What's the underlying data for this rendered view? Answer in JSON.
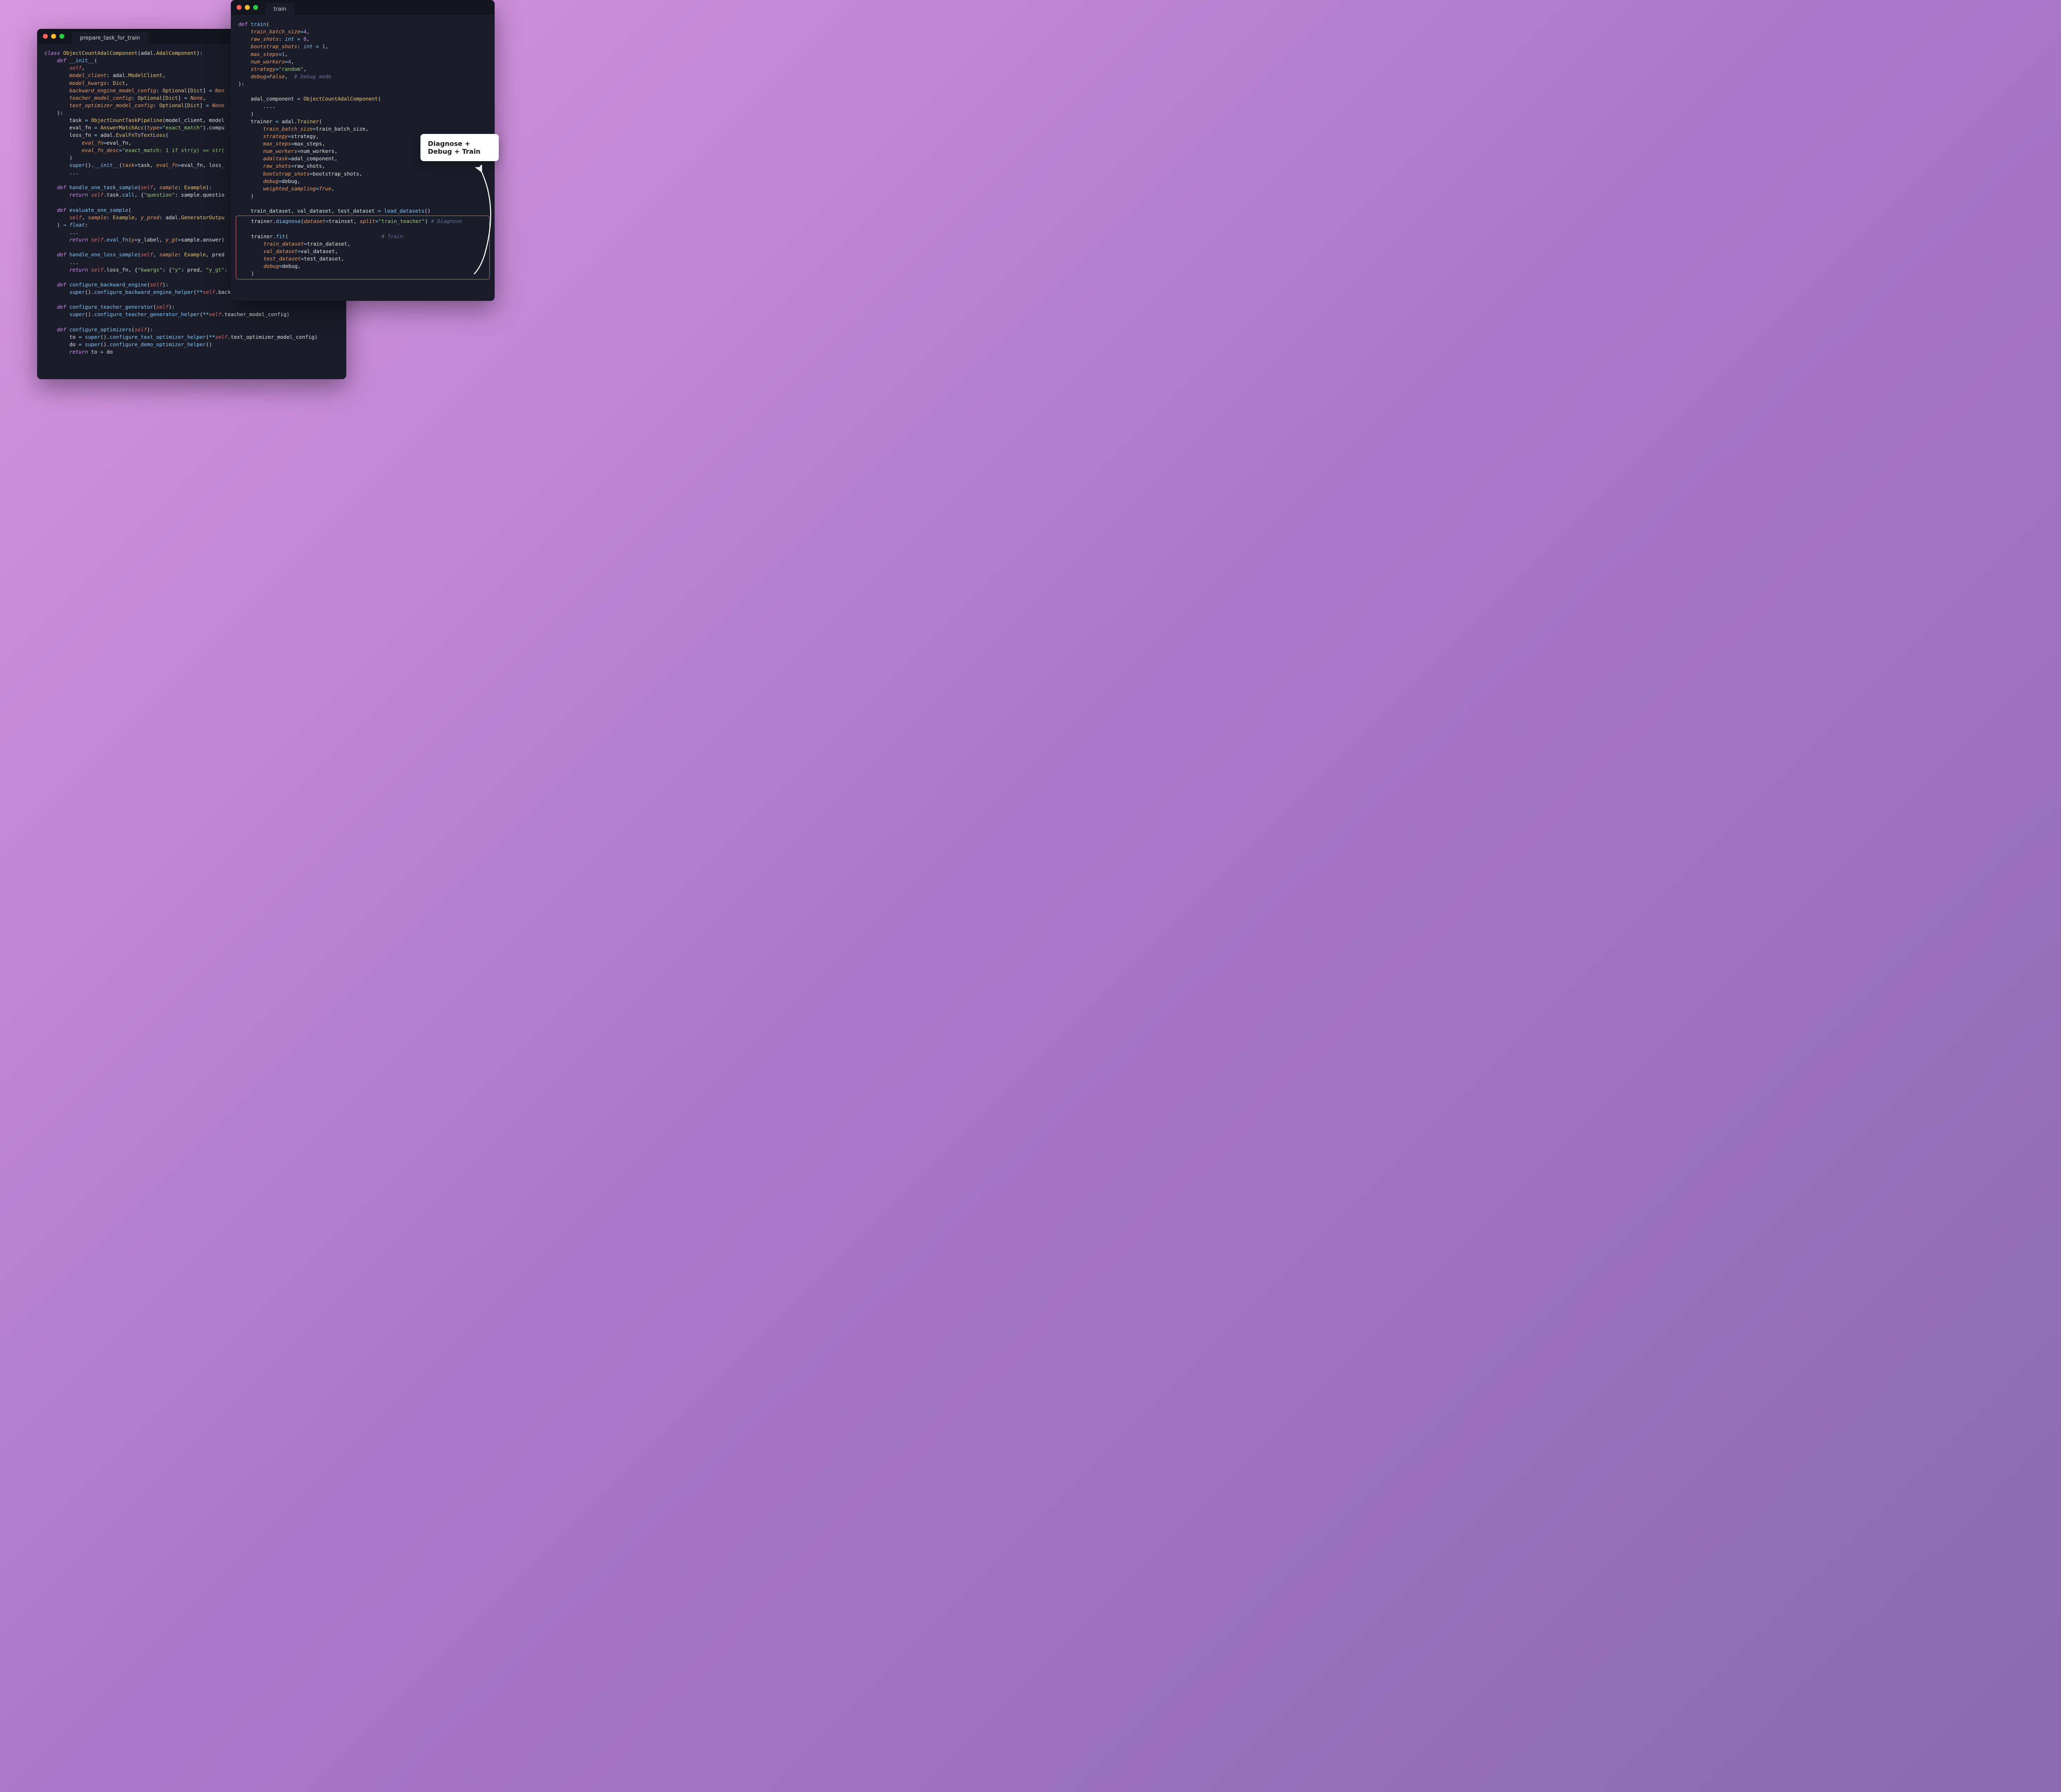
{
  "windows": {
    "back": {
      "tab_title": "prepare_task_for_train"
    },
    "front": {
      "tab_title": "train"
    }
  },
  "callout": {
    "text": "Diagnose + Debug + Train"
  },
  "code_back": {
    "class_decl": "ObjectCountAdalComponent",
    "base": "adal.AdalComponent",
    "init_params": {
      "model_client": "adal.ModelClient",
      "model_kwargs": "Dict",
      "backward_engine_model_config": "Optional[Dict] = None",
      "teacher_model_config": "Optional[Dict] = None",
      "text_optimizer_model_config": "Optional[Dict] = None"
    },
    "task_pipeline": "ObjectCountTaskPipeline",
    "eval_fn": "AnswerMatchAcc",
    "eval_type": "exact_match",
    "loss_fn": "adal.EvalFnToTextLoss",
    "eval_fn_desc": "exact_match: 1 if str(y) == str(",
    "methods": {
      "handle_one_task_sample": {
        "sample_type": "Example",
        "returns_call": "self.task.call",
        "kwkey": "question",
        "kwval": "sample.questio"
      },
      "evaluate_one_sample": {
        "sample_type": "Example",
        "y_pred_type": "adal.GeneratorOutpu",
        "ret_type": "float",
        "call": "self.eval_fn",
        "args": "y=y_label, y_gt=sample.answer)"
      },
      "handle_one_loss_sample": {
        "sample_type": "Example",
        "extra": "pred",
        "call": "self.loss_fn",
        "kw": "{\"kwargs\": {\"y\": pred, \"y_gt\":"
      },
      "configure_backward_engine": {
        "helper": "configure_backward_engine_helper",
        "arg": "self.backward_engine_model_config"
      },
      "configure_teacher_generator": {
        "helper": "configure_teacher_generator_helper",
        "arg": "self.teacher_model_config"
      },
      "configure_optimizers": {
        "to_helper": "configure_text_optimizer_helper",
        "to_arg": "self.text_optimizer_model_config",
        "do_helper": "configure_demo_optimizer_helper"
      }
    }
  },
  "code_front": {
    "fn_name": "train",
    "params": {
      "train_batch_size": "4",
      "raw_shots": {
        "type": "int",
        "default": "0"
      },
      "bootstrap_shots": {
        "type": "int",
        "default": "1"
      },
      "max_steps": "1",
      "num_workers": "4",
      "strategy": "\"random\"",
      "debug": "False",
      "debug_comment": "# Debug mode"
    },
    "adal_component": "ObjectCountAdalComponent",
    "trainer": "adal.Trainer",
    "trainer_args": [
      "train_batch_size=train_batch_size",
      "strategy=strategy",
      "max_steps=max_steps",
      "num_workers=num_workers",
      "adaltask=adal_component",
      "raw_shots=raw_shots",
      "bootstrap_shots=bootstrap_shots",
      "debug=debug",
      "weighted_sampling=True"
    ],
    "load_fn": "load_datasets",
    "diagnose": {
      "dataset": "trainset",
      "split": "\"train_teacher\"",
      "comment": "# Diagnose"
    },
    "fit": {
      "args": [
        "train_dataset=train_dataset",
        "val_dataset=val_dataset",
        "test_dataset=test_dataset",
        "debug=debug"
      ],
      "comment": "# Train"
    }
  }
}
